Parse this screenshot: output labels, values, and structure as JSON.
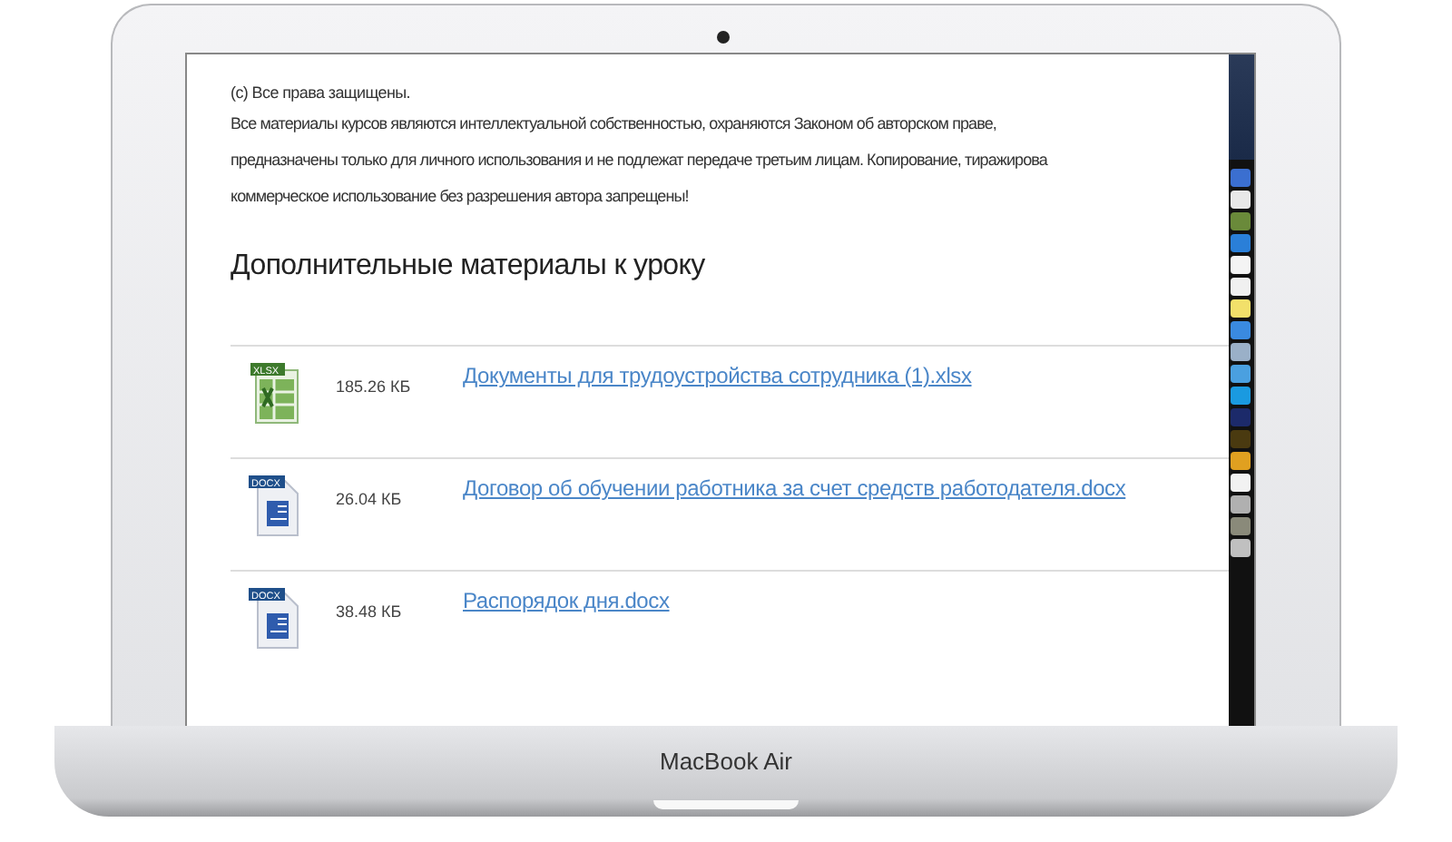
{
  "copyright": {
    "title": "(c) Все права защищены.",
    "lines": [
      "Все материалы курсов являются интеллектуальной собственностью, охраняются Законом об авторском праве,",
      "предназначены только для личного использования и не подлежат передаче третьим лицам. Копирование, тиражирова",
      "коммерческое использование без разрешения автора запрещены!"
    ]
  },
  "section_title": "Дополнительные материалы к уроку",
  "files": [
    {
      "kind": "xlsx",
      "badge": "XLSX",
      "size": "185.26 КБ",
      "name": "Документы для трудоустройства сотрудника (1).xlsx"
    },
    {
      "kind": "docx",
      "badge": "DOCX",
      "size": "26.04 КБ",
      "name": "Договор об обучении работника за счет средств работодателя.docx"
    },
    {
      "kind": "docx",
      "badge": "DOCX",
      "size": "38.48 КБ",
      "name": "Распорядок дня.docx"
    }
  ],
  "laptop_label": "MacBook Air"
}
